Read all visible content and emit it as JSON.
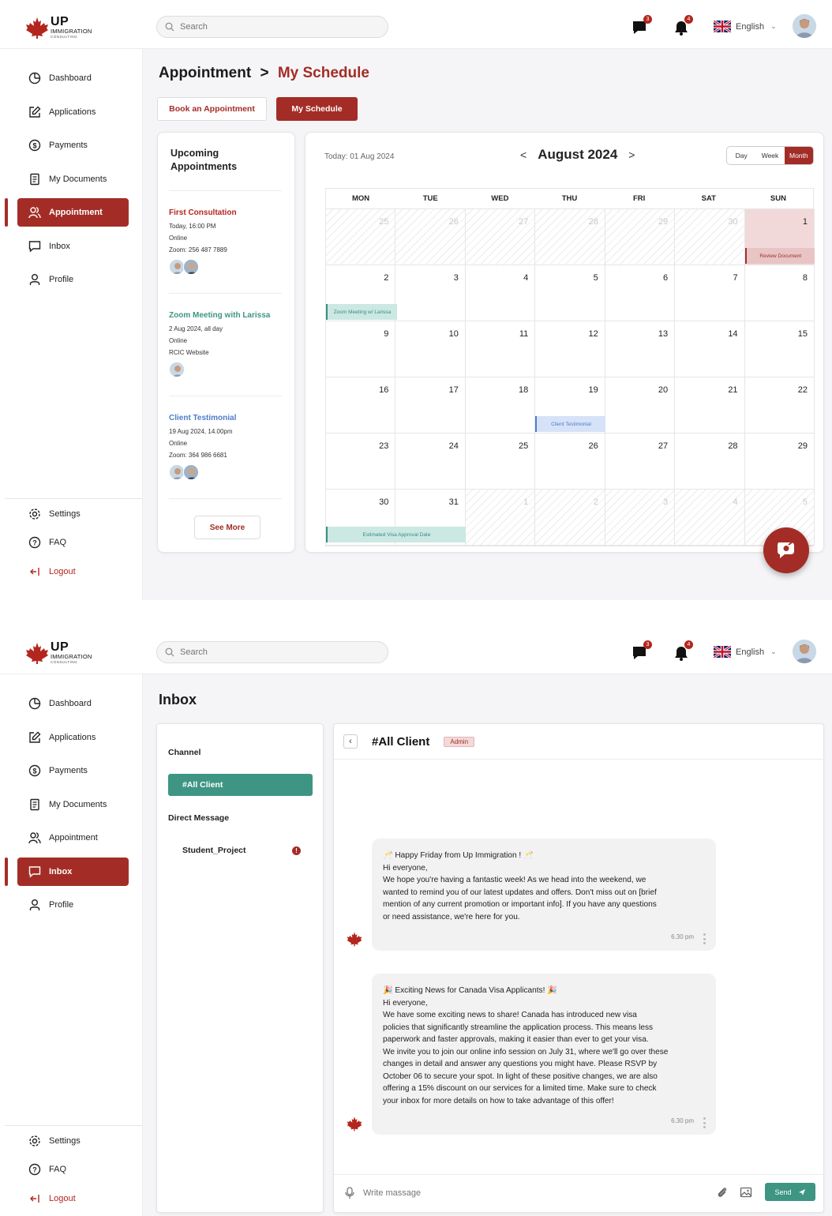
{
  "logo": {
    "up": "UP",
    "immigration": "IMMIGRATION",
    "consulting": "CONSULTING"
  },
  "topbar": {
    "search_placeholder": "Search",
    "messages_count": "3",
    "notifications_count": "4",
    "language": "English"
  },
  "sidebar": {
    "items": [
      {
        "label": "Dashboard",
        "icon": "pie-chart-icon"
      },
      {
        "label": "Applications",
        "icon": "edit-icon"
      },
      {
        "label": "Payments",
        "icon": "dollar-icon"
      },
      {
        "label": "My Documents",
        "icon": "document-icon"
      },
      {
        "label": "Appointment",
        "icon": "users-icon"
      },
      {
        "label": "Inbox",
        "icon": "chat-icon"
      },
      {
        "label": "Profile",
        "icon": "user-icon"
      }
    ],
    "bottom": [
      {
        "label": "Settings",
        "icon": "gear-icon"
      },
      {
        "label": "FAQ",
        "icon": "help-icon"
      },
      {
        "label": "Logout",
        "icon": "logout-icon"
      }
    ]
  },
  "schedule": {
    "breadcrumb_root": "Appointment",
    "breadcrumb_sep": ">",
    "breadcrumb_current": "My Schedule",
    "book_label": "Book an Appointment",
    "myschedule_label": "My Schedule",
    "upcoming_title": "Upcoming Appointments",
    "appointments": [
      {
        "name": "First Consultation",
        "color": "#b3261e",
        "lines": [
          "Today, 16:00 PM",
          "Online",
          "Zoom: 256 487 7889"
        ]
      },
      {
        "name": "Zoom Meeting with Larissa",
        "color": "#3e9583",
        "lines": [
          "2 Aug 2024, all day",
          "Online",
          "RCIC Website"
        ]
      },
      {
        "name": "Client Testimonial",
        "color": "#4f7ccc",
        "lines": [
          "19 Aug 2024, 14.00pm",
          "Online",
          "Zoom: 364 986 6681"
        ]
      }
    ],
    "see_more": "See More",
    "today_label": "Today: 01 Aug 2024",
    "month_label": "August 2024",
    "prev": "<",
    "next": ">",
    "views": [
      "Day",
      "Week",
      "Month"
    ],
    "active_view": "Month",
    "weekdays": [
      "MON",
      "TUE",
      "WED",
      "THU",
      "FRI",
      "SAT",
      "SUN"
    ],
    "weeks": [
      [
        "25",
        "26",
        "27",
        "28",
        "29",
        "30",
        "1"
      ],
      [
        "2",
        "3",
        "4",
        "5",
        "6",
        "7",
        "8"
      ],
      [
        "9",
        "10",
        "11",
        "12",
        "13",
        "14",
        "15"
      ],
      [
        "16",
        "17",
        "18",
        "19",
        "20",
        "21",
        "22"
      ],
      [
        "23",
        "24",
        "25",
        "26",
        "27",
        "28",
        "29"
      ],
      [
        "30",
        "31",
        "1",
        "2",
        "3",
        "4",
        "5"
      ]
    ],
    "events": [
      {
        "label": "Review Document",
        "color": "red"
      },
      {
        "label": "Zoom Meeting w/ Larissa",
        "color": "teal"
      },
      {
        "label": "Client Testimonial",
        "color": "blue"
      },
      {
        "label": "Estimated Visa Approval Date",
        "color": "teal"
      }
    ]
  },
  "inbox": {
    "title": "Inbox",
    "channel_label": "Channel",
    "channel": "#All Client",
    "dm_label": "Direct Message",
    "dm_name": "Student_Project",
    "dm_badge": "!",
    "chat_name": "#All Client",
    "chat_role": "Admin",
    "messages": [
      {
        "lines": [
          "🥂 Happy Friday from Up Immigration ! 🥂",
          "Hi everyone,",
          "We hope you're having a fantastic week! As we head into the weekend, we",
          "wanted to remind you of our latest updates and offers. Don't miss out on [brief",
          "mention of any current promotion or important info]. If you have any questions",
          "or need assistance, we're here for you."
        ],
        "time": "6.30 pm"
      },
      {
        "lines": [
          "🎉 Exciting News for Canada Visa Applicants! 🎉",
          "Hi everyone,",
          "We have some exciting news to share! Canada has introduced new visa",
          "policies that significantly streamline the application process. This means less",
          "paperwork and faster approvals, making it easier than ever to get your visa.",
          "We invite you to join our online info session on July 31, where we'll go over these",
          "changes in detail and answer any questions you might have. Please RSVP by",
          "October 06 to secure your spot. In light of these positive changes, we are also",
          "offering a 15% discount on our services for a limited time. Make sure to check",
          "your inbox for more details on how to take advantage of this offer!"
        ],
        "time": "6.30 pm"
      }
    ],
    "composer_placeholder": "Write massage",
    "send_label": "Send"
  },
  "colors": {
    "brand": "#a32d26",
    "teal": "#3e9583",
    "blue": "#4f7ccc"
  }
}
